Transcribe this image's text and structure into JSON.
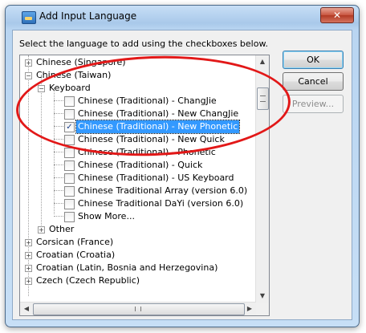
{
  "window": {
    "title": "Add Input Language",
    "close_label": "✕"
  },
  "instruction": "Select the language to add using the checkboxes below.",
  "buttons": {
    "ok": "OK",
    "cancel": "Cancel",
    "preview": "Preview..."
  },
  "tree": [
    {
      "label": "Chinese (Singapore)",
      "level": 0,
      "expander": "+",
      "checkbox": false
    },
    {
      "label": "Chinese (Taiwan)",
      "level": 0,
      "expander": "−",
      "checkbox": false
    },
    {
      "label": "Keyboard",
      "level": 1,
      "expander": "−",
      "checkbox": false
    },
    {
      "label": "Chinese (Traditional) - ChangJie",
      "level": 2,
      "checkbox": true,
      "checked": false
    },
    {
      "label": "Chinese (Traditional) - New ChangJie",
      "level": 2,
      "checkbox": true,
      "checked": false
    },
    {
      "label": "Chinese (Traditional) - New Phonetic",
      "level": 2,
      "checkbox": true,
      "checked": true,
      "selected": true
    },
    {
      "label": "Chinese (Traditional) - New Quick",
      "level": 2,
      "checkbox": true,
      "checked": false
    },
    {
      "label": "Chinese (Traditional) - Phonetic",
      "level": 2,
      "checkbox": true,
      "checked": false
    },
    {
      "label": "Chinese (Traditional) - Quick",
      "level": 2,
      "checkbox": true,
      "checked": false
    },
    {
      "label": "Chinese (Traditional) - US Keyboard",
      "level": 2,
      "checkbox": true,
      "checked": false
    },
    {
      "label": "Chinese Traditional Array (version 6.0)",
      "level": 2,
      "checkbox": true,
      "checked": false
    },
    {
      "label": "Chinese Traditional DaYi (version 6.0)",
      "level": 2,
      "checkbox": true,
      "checked": false
    },
    {
      "label": "Show More...",
      "level": 2,
      "checkbox": true,
      "checked": false
    },
    {
      "label": "Other",
      "level": 1,
      "expander": "+",
      "checkbox": false
    },
    {
      "label": "Corsican (France)",
      "level": 0,
      "expander": "+",
      "checkbox": false
    },
    {
      "label": "Croatian (Croatia)",
      "level": 0,
      "expander": "+",
      "checkbox": false
    },
    {
      "label": "Croatian (Latin, Bosnia and Herzegovina)",
      "level": 0,
      "expander": "+",
      "checkbox": false
    },
    {
      "label": "Czech (Czech Republic)",
      "level": 0,
      "expander": "+",
      "checkbox": false
    }
  ],
  "icons": {
    "scroll_up": "▲",
    "scroll_down": "▼",
    "scroll_left": "◀",
    "scroll_right": "▶",
    "check_mark": "✓"
  },
  "colors": {
    "selection": "#3399ff",
    "annotation": "#e21818"
  }
}
